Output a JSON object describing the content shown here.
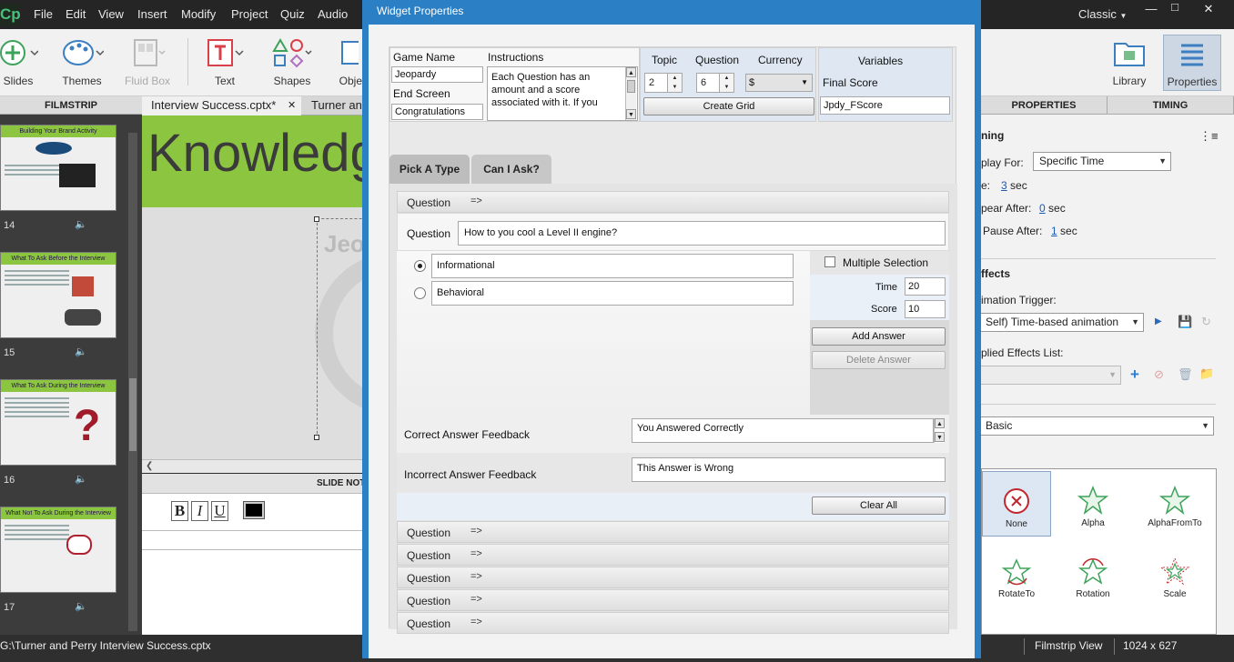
{
  "app": {
    "logo": "Cp",
    "menu": [
      "File",
      "Edit",
      "View",
      "Insert",
      "Modify",
      "Project",
      "Quiz",
      "Audio"
    ],
    "workspace": "Classic",
    "toolbar": [
      {
        "label": "Slides",
        "icon": "add-slide-icon"
      },
      {
        "label": "Themes",
        "icon": "palette-icon"
      },
      {
        "label": "Fluid Box",
        "icon": "fluid-box-icon"
      },
      {
        "label": "Text",
        "icon": "text-icon"
      },
      {
        "label": "Shapes",
        "icon": "shapes-icon"
      },
      {
        "label": "Obje",
        "icon": "objects-icon"
      },
      {
        "label": "Library",
        "icon": "library-icon"
      },
      {
        "label": "Properties",
        "icon": "properties-icon"
      }
    ]
  },
  "filmstrip": {
    "header": "FILMSTRIP",
    "slides": [
      {
        "num": "14",
        "title": "Building Your Brand Activity"
      },
      {
        "num": "15",
        "title": "What To Ask Before the Interview"
      },
      {
        "num": "16",
        "title": "What To Ask During the Interview"
      },
      {
        "num": "17",
        "title": "What Not To Ask During the Interview"
      }
    ]
  },
  "document": {
    "tabs": [
      "Interview Success.cptx*",
      "Turner an"
    ],
    "stage_title": "Knowledg",
    "slide_notes": "SLIDE NOT",
    "format_buttons": [
      "B",
      "I",
      "U"
    ]
  },
  "properties": {
    "tabs": [
      "PROPERTIES",
      "TIMING"
    ],
    "timing_section": "ning",
    "display_for_label": "play For:",
    "display_for_value": "Specific Time",
    "time_label": "e:",
    "time_value": "3",
    "appear_after_label": "pear After:",
    "appear_after_value": "0",
    "pause_after_label": "Pause After:",
    "pause_after_value": "1",
    "sec": "sec",
    "effects_section": "ffects",
    "animation_trigger_label": "imation Trigger:",
    "animation_trigger_value": "Self) Time-based animation",
    "applied_effects_label": "plied Effects List:",
    "effect_category": "Basic",
    "effects": [
      "None",
      "Alpha",
      "AlphaFromTo",
      "RotateTo",
      "Rotation",
      "Scale"
    ]
  },
  "status": {
    "path": "G:\\Turner and Perry Interview Success.cptx",
    "view": "Filmstrip View",
    "size": "1024 x 627"
  },
  "dialog": {
    "title": "Widget Properties",
    "game_name_label": "Game Name",
    "game_name_value": "Jeopardy",
    "end_screen_label": "End Screen",
    "end_screen_value": "Congratulations",
    "instructions_label": "Instructions",
    "instructions_text": "Each Question has an amount and a score associated with it. If you",
    "topic_label": "Topic",
    "topic_value": "2",
    "question_label": "Question",
    "question_value": "6",
    "currency_label": "Currency",
    "currency_value": "$",
    "create_grid_label": "Create Grid",
    "variables_label": "Variables",
    "final_score_label": "Final Score",
    "final_score_value": "Jpdy_FScore",
    "tabs": [
      "Pick A Type",
      "Can I Ask?"
    ],
    "question_header": "Question",
    "question_arrow": "=>",
    "question_field_label": "Question",
    "question_text": "How to you cool a Level II engine?",
    "answers": [
      {
        "text": "Informational",
        "selected": true
      },
      {
        "text": "Behavioral",
        "selected": false
      }
    ],
    "multiple_selection_label": "Multiple Selection",
    "time_label": "Time",
    "time_value": "20",
    "score_label": "Score",
    "score_value": "10",
    "add_answer_label": "Add Answer",
    "delete_answer_label": "Delete Answer",
    "correct_feedback_label": "Correct Answer Feedback",
    "correct_feedback_value": "You Answered Correctly",
    "incorrect_feedback_label": "Incorrect Answer Feedback",
    "incorrect_feedback_value": "This Answer is Wrong",
    "clear_all_label": "Clear All",
    "collapsed_questions": [
      "Question",
      "Question",
      "Question",
      "Question",
      "Question"
    ]
  },
  "colors": {
    "dialog_title_bar": "#2b7fc5",
    "slide_band": "#8cc641",
    "next_arrow": "#c8282d"
  }
}
